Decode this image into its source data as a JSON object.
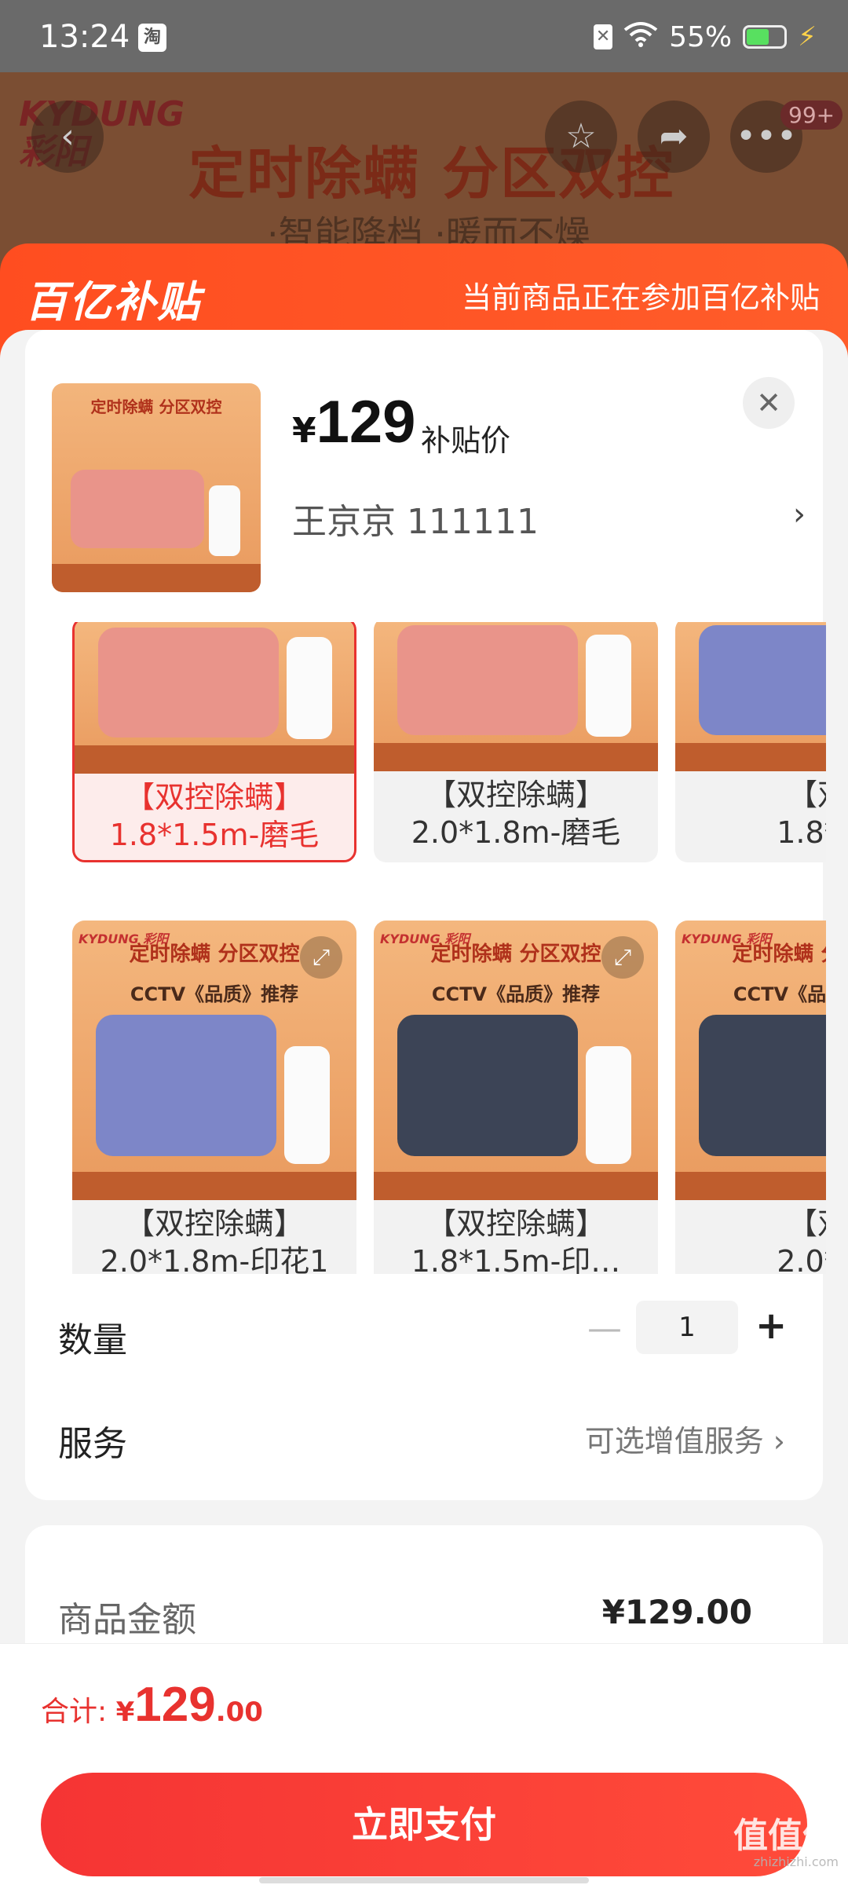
{
  "status_bar": {
    "time": "13:24",
    "app_icon_text": "淘",
    "battery": "55%",
    "battery_level": 0.55
  },
  "background_product": {
    "brand": "KYDUNG\n彩阳",
    "title": "定时除螨 分区双控",
    "subtitle": "·智能降档 ·暖而不燥",
    "cart_badge": "99+"
  },
  "subsidy_banner": {
    "logo": "百亿补贴",
    "text": "当前商品正在参加百亿补贴"
  },
  "product": {
    "price_symbol": "¥",
    "price": "129",
    "price_tag": "补贴价",
    "buyer": "王京京  111111",
    "thumb_title": "定时除螨 分区双控"
  },
  "variants": [
    {
      "label": "【双控除螨】\n1.8*1.5m-磨毛",
      "color": "#e9948a",
      "selected": true
    },
    {
      "label": "【双控除螨】\n2.0*1.8m-磨毛",
      "color": "#e9948a",
      "selected": false
    },
    {
      "label": "【双\n1.8*1",
      "color": "#7d86c8",
      "selected": false
    },
    {
      "label": "【双控除螨】\n2.0*1.8m-印花1",
      "color": "#7d86c8",
      "selected": false
    },
    {
      "label": "【双控除螨】\n1.8*1.5m-印…",
      "color": "#3c4456",
      "selected": false
    },
    {
      "label": "【双\n2.0*1",
      "color": "#3c4456",
      "selected": false
    }
  ],
  "variant_image_text": {
    "brand": "KYDUNG 彩阳",
    "title": "定时除螨 分区双控",
    "cctv": "CCTV《品质》推荐"
  },
  "quantity": {
    "label": "数量",
    "value": "1",
    "minus": "—",
    "plus": "+"
  },
  "service": {
    "label": "服务",
    "value": "可选增值服务 ›"
  },
  "summary": {
    "label": "商品金额",
    "value": "¥129.00"
  },
  "footer": {
    "total_label": "合计: ",
    "total_symbol": "¥",
    "total_int": "129",
    "total_dec": ".00",
    "pay_button": "立即支付",
    "watermark": "值值值",
    "watermark_sub": "zhizhizhi.com"
  }
}
